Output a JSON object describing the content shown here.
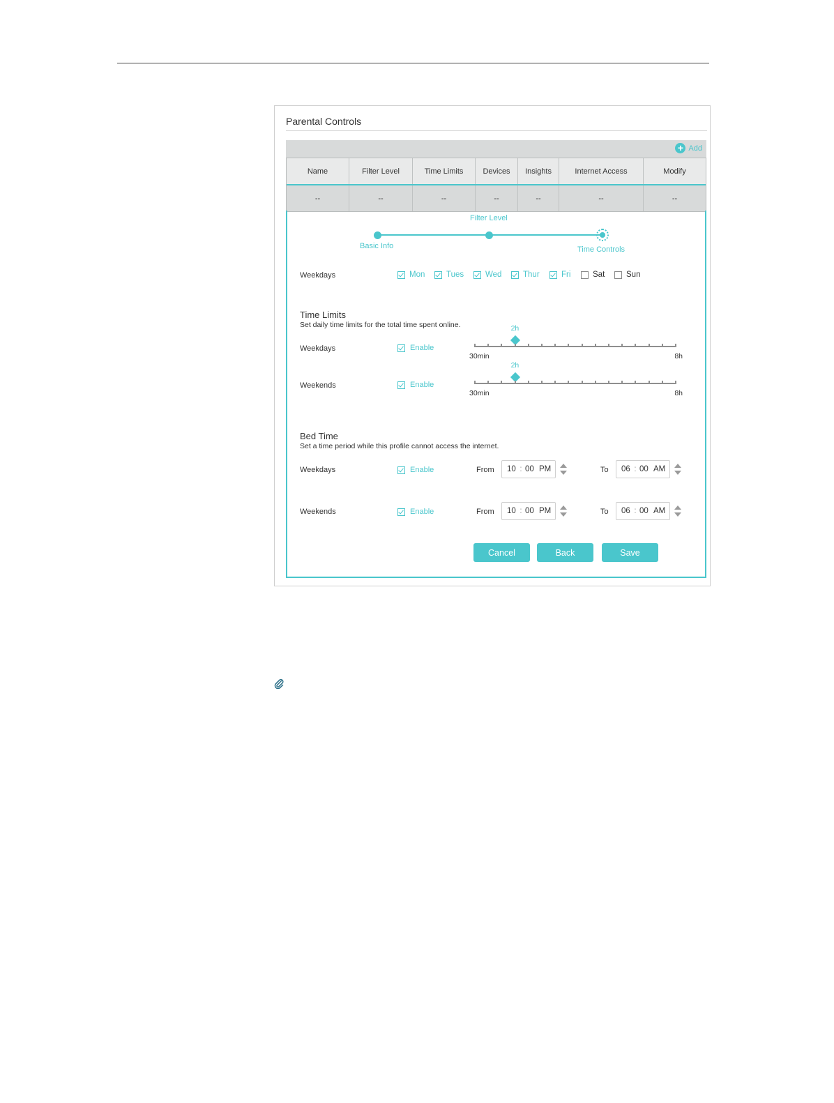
{
  "panel": {
    "title": "Parental Controls",
    "add_label": "Add"
  },
  "table": {
    "headers": [
      "Name",
      "Filter Level",
      "Time Limits",
      "Devices",
      "Insights",
      "Internet Access",
      "Modify"
    ],
    "row": [
      "--",
      "--",
      "--",
      "--",
      "--",
      "--",
      "--"
    ]
  },
  "steps": {
    "basic_info": "Basic Info",
    "filter_level": "Filter Level",
    "time_controls": "Time Controls"
  },
  "weekdays_row": {
    "label": "Weekdays",
    "days": [
      {
        "label": "Mon",
        "checked": true
      },
      {
        "label": "Tues",
        "checked": true
      },
      {
        "label": "Wed",
        "checked": true
      },
      {
        "label": "Thur",
        "checked": true
      },
      {
        "label": "Fri",
        "checked": true
      },
      {
        "label": "Sat",
        "checked": false
      },
      {
        "label": "Sun",
        "checked": false
      }
    ]
  },
  "time_limits": {
    "title": "Time Limits",
    "subtitle": "Set daily time limits for the total time spent online.",
    "weekdays": {
      "label": "Weekdays",
      "enable_label": "Enable",
      "value_label": "2h",
      "min_label": "30min",
      "max_label": "8h",
      "value_hours": 2
    },
    "weekends": {
      "label": "Weekends",
      "enable_label": "Enable",
      "value_label": "2h",
      "min_label": "30min",
      "max_label": "8h",
      "value_hours": 2
    }
  },
  "bed_time": {
    "title": "Bed Time",
    "subtitle": "Set a time period while this profile cannot access the internet.",
    "weekdays": {
      "label": "Weekdays",
      "enable_label": "Enable",
      "from_label": "From",
      "from": {
        "h": "10",
        "m": "00",
        "ap": "PM"
      },
      "to_label": "To",
      "to": {
        "h": "06",
        "m": "00",
        "ap": "AM"
      }
    },
    "weekends": {
      "label": "Weekends",
      "enable_label": "Enable",
      "from_label": "From",
      "from": {
        "h": "10",
        "m": "00",
        "ap": "PM"
      },
      "to_label": "To",
      "to": {
        "h": "06",
        "m": "00",
        "ap": "AM"
      }
    }
  },
  "buttons": {
    "cancel": "Cancel",
    "back": "Back",
    "save": "Save"
  },
  "colors": {
    "accent": "#4ac6cc"
  },
  "icons": {
    "add": "plus-circle-icon",
    "note": "paperclip-icon"
  }
}
